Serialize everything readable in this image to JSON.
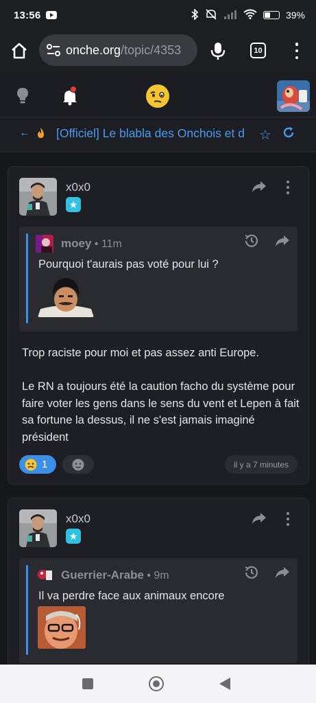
{
  "status_bar": {
    "time": "13:56",
    "battery": "39%"
  },
  "browser": {
    "url_host": "onche.org",
    "url_path": "/topic/4353",
    "tab_count": "10"
  },
  "topic": {
    "title": "[Officiel] Le blabla des Onchois et d"
  },
  "posts": [
    {
      "author": "x0x0",
      "badge_symbol": "★",
      "quote": {
        "author": "moey",
        "time": " • 11m",
        "text": "Pourquoi t'aurais pas voté pour lui ?"
      },
      "body": [
        "Trop raciste pour moi et pas assez anti Europe.",
        "Le RN a toujours été la caution facho du système pour faire voter les gens dans le sens du vent et Lepen à fait sa fortune la dessus, il ne s'est jamais imaginé président"
      ],
      "reaction_count": "1",
      "timestamp": "il y a 7 minutes"
    },
    {
      "author": "x0x0",
      "badge_symbol": "★",
      "quote": {
        "author": "Guerrier-Arabe",
        "time": " • 9m",
        "text": "Il va perdre face aux animaux encore"
      }
    }
  ],
  "colors": {
    "accent": "#4a9bf0",
    "quote_bar": "#3d8ff2",
    "badge": "#33c1e0",
    "reaction_active": "#3c8fe6"
  }
}
